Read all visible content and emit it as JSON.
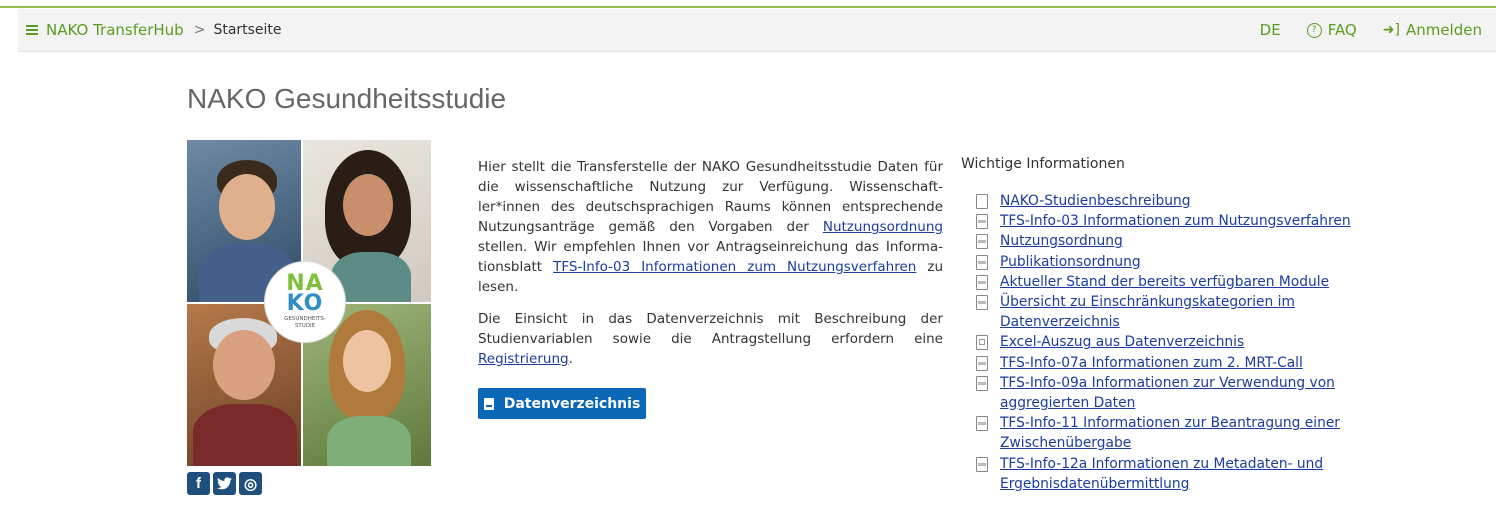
{
  "nav": {
    "brand": "NAKO TransferHub",
    "separator": ">",
    "crumb": "Startseite",
    "lang": "DE",
    "faq": "FAQ",
    "login": "Anmelden"
  },
  "page": {
    "title": "NAKO Gesundheitsstudie"
  },
  "logo": {
    "line1": "NA",
    "line2": "KO",
    "sub": "GESUNDHEITS-\nSTUDIE"
  },
  "intro": {
    "p1_a": "Hier stellt die Transferstelle der NAKO Gesundheitsstudie Daten für die wissenschaftliche Nutzung zur Verfügung. Wissenschaft-ler*innen des deutschsprachigen Raums können entsprechende Nutzungsanträge gemäß den Vorgaben der ",
    "p1_link1": "Nutzungsordnung",
    "p1_b": " stellen. Wir empfehlen Ihnen vor Antragseinreichung das Informa-tionsblatt ",
    "p1_link2": "TFS-Info-03 Informationen zum Nutzungsverfahren",
    "p1_c": " zu lesen.",
    "p2_a": "Die Einsicht in das Datenverzeichnis mit Beschreibung der Studienvariablen sowie die Antragstellung erfordern eine ",
    "p2_link": "Registrierung",
    "p2_b": "."
  },
  "button": {
    "label": "Datenverzeichnis"
  },
  "social": {
    "facebook": "f",
    "instagram": "◎"
  },
  "info": {
    "title": "Wichtige Informationen",
    "links": [
      {
        "label": "NAKO-Studienbeschreibung",
        "icon": "doc-icon"
      },
      {
        "label": "TFS-Info-03 Informationen zum Nutzungsverfahren",
        "icon": "pdf-icon"
      },
      {
        "label": "Nutzungsordnung",
        "icon": "pdf-icon"
      },
      {
        "label": "Publikationsordnung",
        "icon": "pdf-icon"
      },
      {
        "label": "Aktueller Stand der bereits verfügbaren Module",
        "icon": "pdf-icon"
      },
      {
        "label": "Übersicht zu Einschränkungskategorien im Datenverzeichnis",
        "icon": "pdf-icon"
      },
      {
        "label": "Excel-Auszug aus Datenverzeichnis",
        "icon": "xls-icon"
      },
      {
        "label": "TFS-Info-07a Informationen zum 2. MRT-Call",
        "icon": "pdf-icon"
      },
      {
        "label": "TFS-Info-09a Informationen zur Verwendung von aggregierten Daten",
        "icon": "pdf-icon"
      },
      {
        "label": "TFS-Info-11 Informationen zur Beantragung einer Zwischenübergabe",
        "icon": "pdf-icon"
      },
      {
        "label": "TFS-Info-12a Informationen zu Metadaten- und Ergebnisdatenübermittlung",
        "icon": "pdf-icon"
      }
    ]
  },
  "colors": {
    "brand_green": "#5a9c22",
    "button_blue": "#0b68b7",
    "link_blue": "#1a3d9e",
    "social_blue": "#1f4f7d"
  }
}
